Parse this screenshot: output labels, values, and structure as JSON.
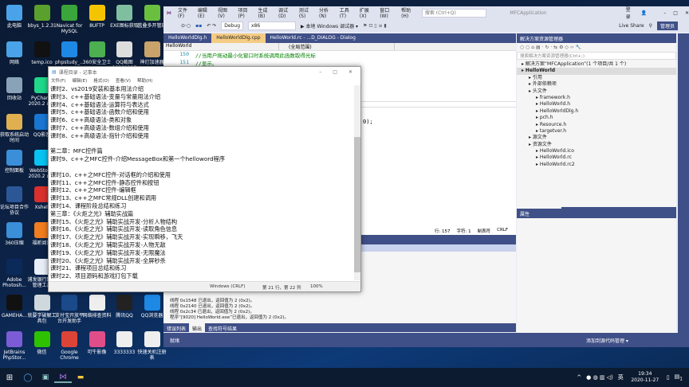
{
  "desktop": {
    "icons": [
      {
        "label": "此电脑",
        "col": 0,
        "row": 0,
        "color": "#4aa3e8"
      },
      {
        "label": "bbys_1.2.31",
        "col": 1,
        "row": 0,
        "color": "#5aa02c"
      },
      {
        "label": "Navicat for MySQL",
        "col": 2,
        "row": 0,
        "color": "#3aa53a"
      },
      {
        "label": "8UFTP",
        "col": 3,
        "row": 0,
        "color": "#f5c400"
      },
      {
        "label": "EXE图标获取",
        "col": 4,
        "row": 0,
        "color": "#7fbfa0"
      },
      {
        "label": "蓝叠多开管理",
        "col": 5,
        "row": 0,
        "color": "#6bbf3f"
      },
      {
        "label": "网络",
        "col": 0,
        "row": 1,
        "color": "#4aa3e8"
      },
      {
        "label": "temp.ico",
        "col": 1,
        "row": 1,
        "color": "#111111"
      },
      {
        "label": "phpstudy_...",
        "col": 2,
        "row": 1,
        "color": "#1e88e5"
      },
      {
        "label": "360安全卫士",
        "col": 3,
        "row": 1,
        "color": "#4caf50"
      },
      {
        "label": "QQ截图20201127",
        "col": 4,
        "row": 1,
        "color": "#dddddd"
      },
      {
        "label": "神灯加速器",
        "col": 5,
        "row": 1,
        "color": "#c9a36a"
      },
      {
        "label": "回收站",
        "col": 0,
        "row": 2,
        "color": "#8aa2b8"
      },
      {
        "label": "PyCharm 2020.2 x64",
        "col": 1,
        "row": 2,
        "color": "#21d789"
      },
      {
        "label": "获取系统启动时间",
        "col": 0,
        "row": 3,
        "color": "#e0b050"
      },
      {
        "label": "QQ影音",
        "col": 1,
        "row": 3,
        "color": "#1976d2"
      },
      {
        "label": "控制面板",
        "col": 0,
        "row": 4,
        "color": "#3a8fd8"
      },
      {
        "label": "WebStorm 2020.2 x64",
        "col": 1,
        "row": 4,
        "color": "#07c3f2"
      },
      {
        "label": "论坛项目合作协议",
        "col": 0,
        "row": 5,
        "color": "#2b5797"
      },
      {
        "label": "Xshell",
        "col": 1,
        "row": 5,
        "color": "#d9302c"
      },
      {
        "label": "360压缩",
        "col": 0,
        "row": 6,
        "color": "#3a8fd8"
      },
      {
        "label": "福昕阅读",
        "col": 1,
        "row": 6,
        "color": "#f07d1f"
      },
      {
        "label": "Adobe Photosh...",
        "col": 0,
        "row": 7,
        "color": "#0b2a5a"
      },
      {
        "label": "浦发银行网银管理工具",
        "col": 1,
        "row": 7,
        "color": "#e8eef8"
      },
      {
        "label": "GAMEHA...",
        "col": 0,
        "row": 8,
        "color": "#111111"
      },
      {
        "label": "就要学破解工具包",
        "col": 1,
        "row": 8,
        "color": "#cfd8dc"
      },
      {
        "label": "支付宝开放平台开发助手",
        "col": 2,
        "row": 8,
        "color": "#1a4a8a"
      },
      {
        "label": "网络排查资料",
        "col": 3,
        "row": 8,
        "color": "#eeeeee"
      },
      {
        "label": "腾讯QQ",
        "col": 4,
        "row": 8,
        "color": "#222222"
      },
      {
        "label": "QQ浏览器",
        "col": 5,
        "row": 8,
        "color": "#1e88e5"
      },
      {
        "label": "JetBrains PhpStor...",
        "col": 0,
        "row": 9,
        "color": "#7b5cd6"
      },
      {
        "label": "微信",
        "col": 1,
        "row": 9,
        "color": "#2dc100"
      },
      {
        "label": "Google Chrome",
        "col": 2,
        "row": 9,
        "color": "#db4437"
      },
      {
        "label": "可牛影像",
        "col": 3,
        "row": 9,
        "color": "#e04e8a"
      },
      {
        "label": "3333333",
        "col": 4,
        "row": 9,
        "color": "#eeeeee"
      },
      {
        "label": "快速关机注册表",
        "col": 5,
        "row": 9,
        "color": "#eeeeee"
      }
    ]
  },
  "vs": {
    "menu": [
      "文件(F)",
      "编辑(E)",
      "视图(V)",
      "项目(P)",
      "生成(B)",
      "调试(D)",
      "测试(S)",
      "分析(N)",
      "工具(T)",
      "扩展(X)",
      "窗口(W)",
      "帮助(H)"
    ],
    "search_placeholder": "搜索 (Ctrl+Q)",
    "solution_name": "MFCApplication",
    "login": "登录",
    "config": "Debug",
    "platform": "x86",
    "debugger": "▶ 本地 Windows 调试器 ▾",
    "live_share": "Live Share",
    "admin": "管理员",
    "tabs": [
      {
        "label": "HelloWorldDlg.h",
        "active": false
      },
      {
        "label": "HelloWorldDlg.cpp",
        "active": true
      },
      {
        "label": "HelloWorld.rc - ...D_DIALOG - Dialog",
        "active": false
      }
    ],
    "nav_project": "HelloWorld",
    "nav_scope": "(全局范围)",
    "code": [
      {
        "num": "150",
        "text": "//当用户拖动最小化窗口时系统调用此函数取得光标"
      },
      {
        "num": "151",
        "text": "//显示。"
      }
    ],
    "code_fragment": "0);",
    "editor_status": {
      "line": "行: 157",
      "char": "字符: 1",
      "tabs": "制表符",
      "eol": "CRLF"
    },
    "output_lines": [
      "线程 0x1548 已退出，返回值为 2 (0x2)。",
      "线程 0x2140 已退出，返回值为 2 (0x2)。",
      "线程 0x2c34 已退出，返回值为 2 (0x2)。",
      "程序“[9020] HelloWorld.exe”已退出，返回值为 2 (0x2)。"
    ],
    "bottom_tabs": [
      "错误列表",
      "输出",
      "查找符号结果"
    ],
    "status": "就绪",
    "source_control": "添加到源代码管理 ▾",
    "solution_explorer": {
      "title": "解决方案资源管理器",
      "search_placeholder": "搜索解决方案资源管理器(Ctrl+;)",
      "tree": [
        {
          "t": "解决方案“MFCApplication”(1 个项目/共 1 个)",
          "d": 0
        },
        {
          "t": "HelloWorld",
          "d": 0,
          "bold": true
        },
        {
          "t": "引用",
          "d": 1
        },
        {
          "t": "外部依赖项",
          "d": 1
        },
        {
          "t": "头文件",
          "d": 1
        },
        {
          "t": "framework.h",
          "d": 2
        },
        {
          "t": "HelloWorld.h",
          "d": 2
        },
        {
          "t": "HelloWorldDlg.h",
          "d": 2
        },
        {
          "t": "pch.h",
          "d": 2
        },
        {
          "t": "Resource.h",
          "d": 2
        },
        {
          "t": "targetver.h",
          "d": 2
        },
        {
          "t": "源文件",
          "d": 1
        },
        {
          "t": "资源文件",
          "d": 1
        },
        {
          "t": "HelloWorld.ico",
          "d": 2
        },
        {
          "t": "HelloWorld.rc",
          "d": 2
        },
        {
          "t": "HelloWorld.rc2",
          "d": 2
        }
      ],
      "tabs": [
        "解决方案资源管理器",
        "团队资源管理器",
        "资源视图"
      ]
    },
    "properties_title": "属性"
  },
  "notepad": {
    "title": "课程目录 - 记事本",
    "menu": [
      "文件(F)",
      "编辑(E)",
      "格式(O)",
      "查看(V)",
      "帮助(H)"
    ],
    "lines": [
      "课时2、vs2019安装和基本用法介绍",
      "课时3、c++基础语法-变量与常量用法介绍",
      "课时4、c++基础语法-运算符与表达式",
      "课时5、c++基础语法-函数介绍和使用",
      "课时6、c++高级语法-类和对象",
      "课时7、c++高级语法-数组介绍和使用",
      "课时8、c++高级语法-指针介绍和使用",
      "",
      "第二章：MFC控件篇",
      "课时9、c++之MFC控件-介绍MessageBox和第一个helloword程序",
      "",
      "课时10、c++之MFC控件-对话框的介绍和使用",
      "课时11、c++之MFC控件-静态控件和按钮",
      "课时12、c++之MFC控件-编辑框",
      "课时13、c++之MFC常规DLL创建和调用",
      "课时14、课程阶段总结和练习",
      "第三章：《火炬之光》辅助实战篇",
      "课时15、《火炬之光》辅助实战开发-分析人物结构",
      "课时16、《火炬之光》辅助实战开发-读取角色信息",
      "课时17、《火炬之光》辅助实战开发-实现瞬移，飞天",
      "课时18、《火炬之光》辅助实战开发-人物无敌",
      "课时19、《火炬之光》辅助实战开发-无限魔法",
      "课时20、《火炬之光》辅助实战开发-全屏秒杀",
      "课时21、课程项目总结和练习",
      "课时22、项目源码和游戏打包下载"
    ],
    "status": {
      "encoding": "Windows (CRLF)",
      "position": "第 21 行，第 22 列",
      "zoom": "100%"
    }
  },
  "taskbar": {
    "time": "19:34",
    "date": "2020-11-27",
    "ime": "英",
    "notification_count": "1"
  }
}
